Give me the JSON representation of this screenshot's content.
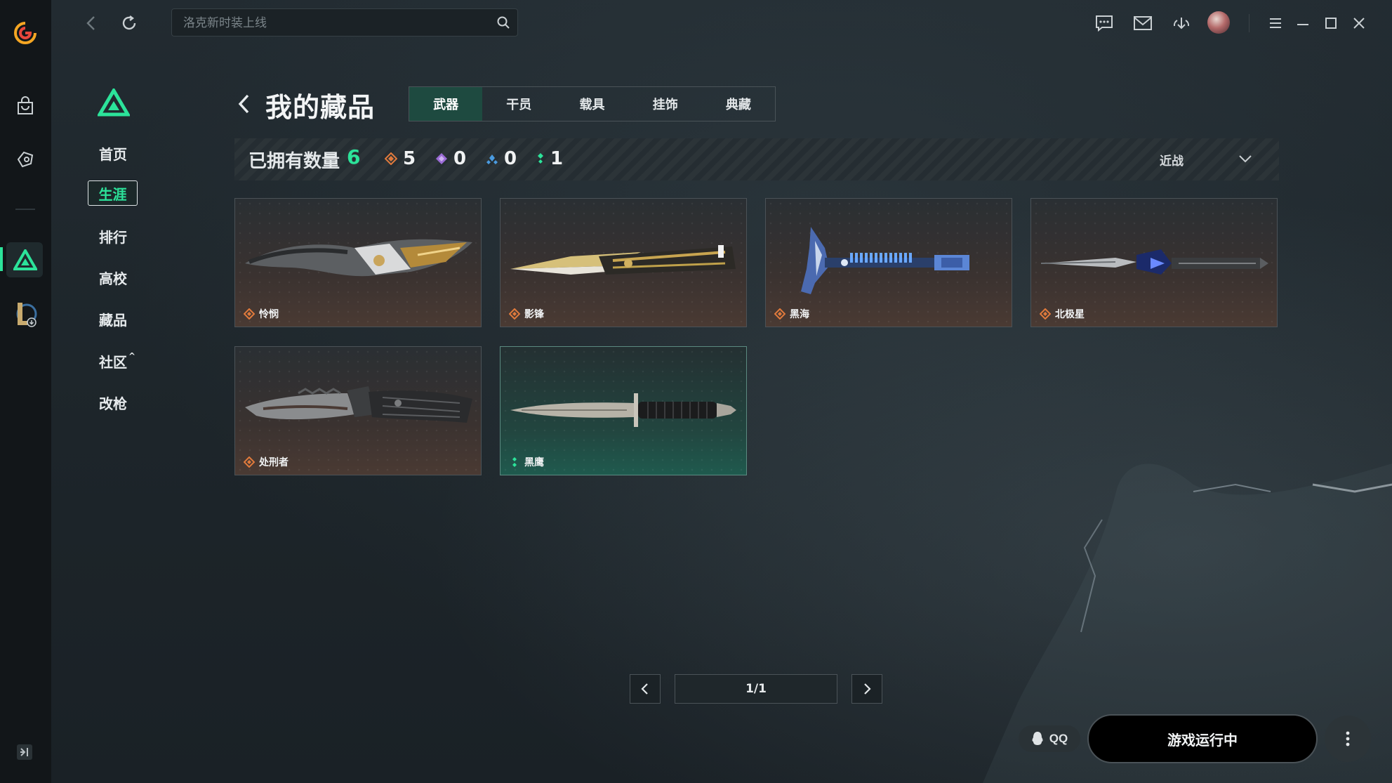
{
  "colors": {
    "accent_green": "#2ce39a",
    "orange_rarity": "#e07a3c",
    "purple_rarity": "#9b6bd6",
    "blue_rarity": "#4a9be0",
    "green_rarity": "#2ce39a",
    "active_tab_bg": "#1e4a40"
  },
  "topbar": {
    "search_placeholder": "洛克新时装上线",
    "icons": [
      "back-icon",
      "refresh-icon",
      "search-icon",
      "chat-icon",
      "mail-icon",
      "download-icon",
      "avatar",
      "menu-icon",
      "minimize-icon",
      "maximize-icon",
      "close-icon"
    ]
  },
  "rail": {
    "icons": [
      "app-logo-icon",
      "store-bag-icon",
      "game-controller-icon",
      "delta-force-icon",
      "league-icon",
      "collapse-icon"
    ]
  },
  "sidebar": {
    "items": [
      {
        "label": "首页"
      },
      {
        "label": "生涯"
      },
      {
        "label": "排行"
      },
      {
        "label": "高校"
      },
      {
        "label": "藏品"
      },
      {
        "label": "社区"
      },
      {
        "label": "改枪"
      }
    ],
    "active_index": 1,
    "community_chevron": "^"
  },
  "main": {
    "title": "我的藏品",
    "tabs": [
      {
        "label": "武器"
      },
      {
        "label": "干员"
      },
      {
        "label": "载具"
      },
      {
        "label": "挂饰"
      },
      {
        "label": "典藏"
      }
    ],
    "active_tab": 0,
    "stats": {
      "owned_label": "已拥有数量",
      "owned_count": "6",
      "rarities": [
        {
          "name": "orange",
          "count": "5"
        },
        {
          "name": "purple",
          "count": "0"
        },
        {
          "name": "blue",
          "count": "0"
        },
        {
          "name": "green",
          "count": "1"
        }
      ],
      "filter": "近战"
    },
    "items": [
      {
        "name": "怜悯",
        "rarity": "orange"
      },
      {
        "name": "影锋",
        "rarity": "orange"
      },
      {
        "name": "黑海",
        "rarity": "orange"
      },
      {
        "name": "北极星",
        "rarity": "orange"
      },
      {
        "name": "处刑者",
        "rarity": "orange"
      },
      {
        "name": "黑鹰",
        "rarity": "green"
      }
    ],
    "pager": {
      "text": "1/1"
    }
  },
  "footer": {
    "qq_label": "QQ",
    "game_button": "游戏运行中"
  }
}
